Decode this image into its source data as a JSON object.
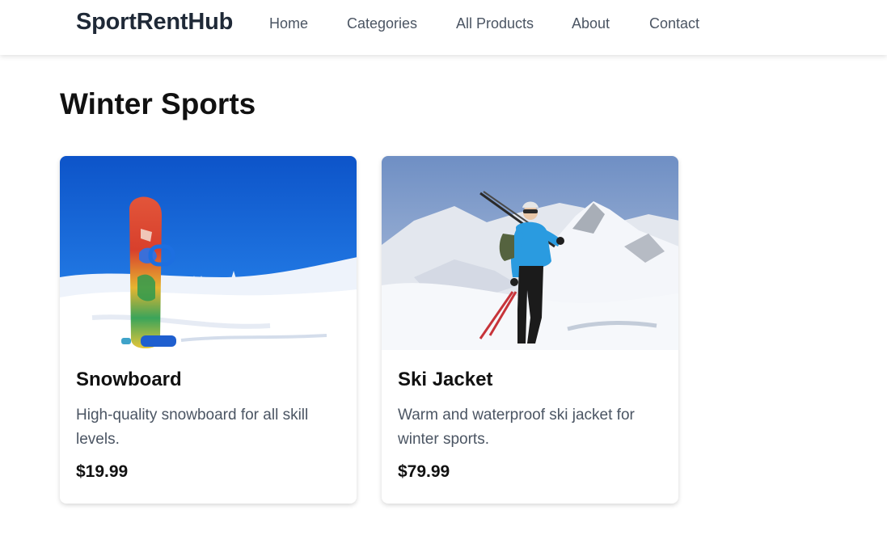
{
  "header": {
    "brand": "SportRentHub",
    "nav": [
      {
        "label": "Home"
      },
      {
        "label": "Categories"
      },
      {
        "label": "All Products"
      },
      {
        "label": "About"
      },
      {
        "label": "Contact"
      }
    ]
  },
  "main": {
    "title": "Winter Sports",
    "products": [
      {
        "name": "Snowboard",
        "description": "High-quality snowboard for all skill levels.",
        "price": "$19.99",
        "image_icon": "snowboard-photo"
      },
      {
        "name": "Ski Jacket",
        "description": "Warm and waterproof ski jacket for winter sports.",
        "price": "$79.99",
        "image_icon": "skier-photo"
      }
    ]
  },
  "colors": {
    "brand_text": "#1f2937",
    "nav_text": "#4b5563",
    "heading": "#111111",
    "muted_text": "#4b5563"
  }
}
